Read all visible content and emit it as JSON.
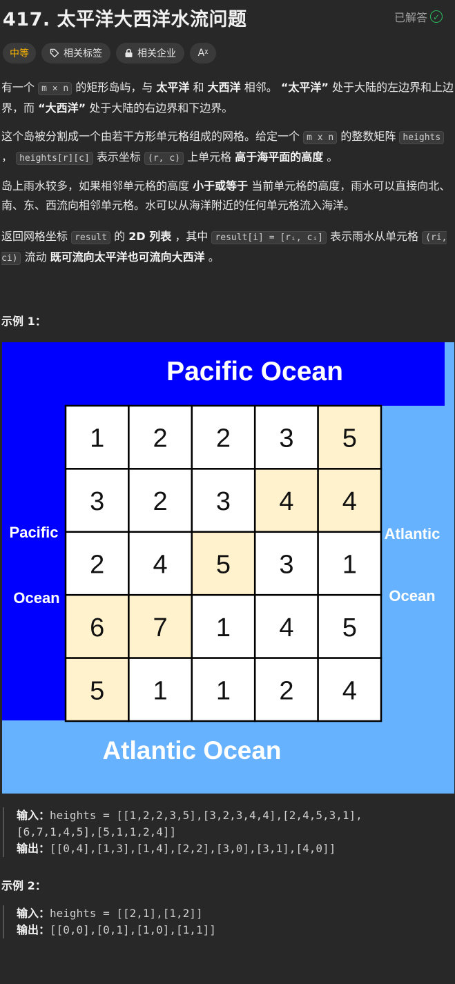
{
  "header": {
    "title": "417. 太平洋大西洋水流问题",
    "status": "已解答",
    "status_icon": "check-circle-icon"
  },
  "tags": {
    "level": "中等",
    "related_tags": "相关标签",
    "related_companies": "相关企业",
    "font_size_icon": "Aᵡ"
  },
  "description": {
    "p1": {
      "a": "有一个 ",
      "code1": "m × n",
      "b": " 的矩形岛屿，与 ",
      "b1": "太平洋",
      "c": " 和 ",
      "b2": "大西洋",
      "d": " 相邻。 ",
      "b3": "“太平洋”",
      "e": " 处于大陆的左边界和上边界，而 ",
      "b4": "“大西洋”",
      "f": " 处于大陆的右边界和下边界。"
    },
    "p2": {
      "a": "这个岛被分割成一个由若干方形单元格组成的网格。给定一个 ",
      "code1": "m x n",
      "b": " 的整数矩阵 ",
      "code2": "heights",
      "c": " ， ",
      "code3": "heights[r][c]",
      "d": " 表示坐标 ",
      "code4": "(r, c)",
      "e": " 上单元格 ",
      "b1": "高于海平面的高度",
      "f": " 。"
    },
    "p3": {
      "a": "岛上雨水较多，如果相邻单元格的高度 ",
      "b1": "小于或等于",
      "b": " 当前单元格的高度，雨水可以直接向北、南、东、西流向相邻单元格。水可以从海洋附近的任何单元格流入海洋。"
    },
    "p4": {
      "a": "返回网格坐标 ",
      "code1": "result",
      "b": " 的 ",
      "b1": "2D 列表",
      "c": " ，其中 ",
      "code2": "result[i] = [rᵢ, cᵢ]",
      "d": " 表示雨水从单元格 ",
      "code3": "(ri, ci)",
      "e": " 流动 ",
      "b2": "既可流向太平洋也可流向大西洋",
      "f": " 。"
    }
  },
  "example1": {
    "title": "示例 1：",
    "figure": {
      "top_label": "Pacific Ocean",
      "bottom_label": "Atlantic Ocean",
      "left_label_1": "Pacific",
      "left_label_2": "Ocean",
      "right_label_1": "Atlantic",
      "right_label_2": "Ocean",
      "grid": [
        [
          1,
          2,
          2,
          3,
          5
        ],
        [
          3,
          2,
          3,
          4,
          4
        ],
        [
          2,
          4,
          5,
          3,
          1
        ],
        [
          6,
          7,
          1,
          4,
          5
        ],
        [
          5,
          1,
          1,
          2,
          4
        ]
      ],
      "highlighted": [
        [
          0,
          4
        ],
        [
          1,
          3
        ],
        [
          1,
          4
        ],
        [
          2,
          2
        ],
        [
          3,
          0
        ],
        [
          3,
          1
        ],
        [
          4,
          0
        ]
      ],
      "colors": {
        "pacific": "#0000ff",
        "atlantic": "#66b2ff",
        "highlight": "#fff2cc",
        "cell": "#ffffff"
      }
    },
    "input_label": "输入：",
    "input_line1": "heights = [[1,2,2,3,5],[3,2,3,4,4],[2,4,5,3,1],",
    "input_line2": "[6,7,1,4,5],[5,1,1,2,4]]",
    "output_label": "输出：",
    "output": "[[0,4],[1,3],[1,4],[2,2],[3,0],[3,1],[4,0]]"
  },
  "example2": {
    "title": "示例 2：",
    "input_label": "输入：",
    "input": "heights = [[2,1],[1,2]]",
    "output_label": "输出：",
    "output": "[[0,0],[0,1],[1,0],[1,1]]"
  }
}
